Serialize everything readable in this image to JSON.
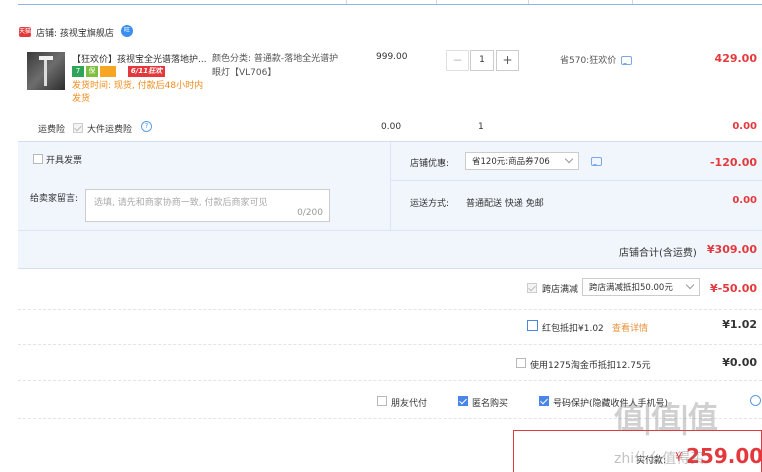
{
  "shop": {
    "badge": "天猫",
    "name": "店铺: 孩视宝旗舰店",
    "wangwang": "旺"
  },
  "item": {
    "title": "【狂欢价】孩视宝全光谱落地护...",
    "tags": [
      "7",
      "保",
      "",
      ""
    ],
    "promo_tag": "6/11狂欢",
    "shipping_note": "发货时间: 现货, 付款后48小时内发货",
    "spec": "颜色分类: 普通款-落地全光谱护眼灯【VL706】",
    "unit_price": "999.00",
    "quantity": "1",
    "minus": "−",
    "plus": "+",
    "discount_note": "省570:狂欢价",
    "subtotal": "429.00"
  },
  "insurance": {
    "label": "运费险",
    "option": "大件运费险",
    "help": "?",
    "price": "0.00",
    "qty": "1",
    "total": "0.00"
  },
  "invoice": {
    "label": "开具发票"
  },
  "coupon": {
    "label": "店铺优惠:",
    "selected": "省120元:商品券706",
    "amount": "-120.00"
  },
  "message": {
    "label": "给卖家留言:",
    "placeholder": "选填, 请先和商家协商一致, 付款后商家可见",
    "counter": "0/200"
  },
  "delivery": {
    "label": "运送方式:",
    "value": "普通配送 快递 免邮",
    "amount": "0.00"
  },
  "shop_total": {
    "label": "店铺合计(含运费)",
    "amount": "¥309.00"
  },
  "cross_shop": {
    "label": "跨店满减",
    "selected": "跨店满减抵扣50.00元",
    "amount": "¥-50.00"
  },
  "red_packet": {
    "label": "红包抵扣¥1.02",
    "link": "查看详情",
    "amount": "¥1.02"
  },
  "taojinbi": {
    "label": "使用1275淘金币抵扣12.75元",
    "amount": "¥0.00"
  },
  "options": {
    "friend_pay": "朋友代付",
    "anonymous": "匿名购买",
    "number_protect": "号码保护(隐藏收件人手机号)"
  },
  "pay": {
    "label": "实付款:",
    "currency": "¥",
    "amount": "259.00"
  },
  "watermark": {
    "logo": "值|值|值",
    "site": "zhi什么值得买"
  }
}
